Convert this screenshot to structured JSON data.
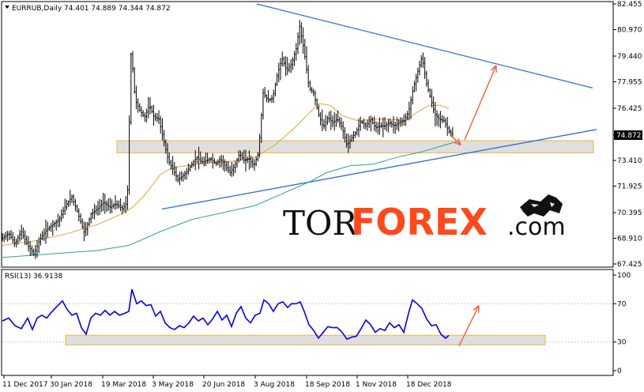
{
  "header": {
    "menu_icon": "triangle-down-icon",
    "symbol_info": "EURRUB,Daily  74.401 74.889 74.344 74.872"
  },
  "rsi_header": "RSI(13) 36.9138",
  "watermark": {
    "logo_icon": "bull-bear-icon",
    "tor": "TOR",
    "forex": "FOREX",
    "dotcom": ".com"
  },
  "colors": {
    "background": "#ffffff",
    "candle": "#000000",
    "ma_fast": "#e0a43a",
    "ma_slow": "#2aa58a",
    "trendline": "#2e6fd6",
    "arrow": "#ff5a3c",
    "zone_fill": "#d9d9d9",
    "zone_border": "#f0b43c",
    "rsi_line": "#0000ee",
    "watermark_tor": "#111111",
    "watermark_forex": "#ff4a1c"
  },
  "chart_data": [
    {
      "type": "candlestick",
      "symbol": "EURRUB",
      "timeframe": "Daily",
      "ylim": [
        67.425,
        82.455
      ],
      "y_ticks": [
        "82.455",
        "80.970",
        "79.440",
        "77.955",
        "76.425",
        "74.872",
        "73.410",
        "71.925",
        "70.395",
        "68.910",
        "67.425"
      ],
      "current_price": "74.872",
      "x_ticks": [
        "11 Dec 2017",
        "30 Jan 2018",
        "19 Mar 2018",
        "3 May 2018",
        "20 Jun 2018",
        "3 Aug 2018",
        "18 Sep 2018",
        "1 Nov 2018",
        "18 Dec 2018"
      ],
      "close_path": [
        [
          0,
          68.9
        ],
        [
          8,
          69.2
        ],
        [
          16,
          68.6
        ],
        [
          24,
          69.3
        ],
        [
          32,
          68.5
        ],
        [
          40,
          68.0
        ],
        [
          48,
          68.9
        ],
        [
          56,
          69.4
        ],
        [
          64,
          69.7
        ],
        [
          72,
          70.0
        ],
        [
          80,
          70.8
        ],
        [
          88,
          71.3
        ],
        [
          96,
          70.3
        ],
        [
          104,
          69.2
        ],
        [
          112,
          70.3
        ],
        [
          120,
          70.6
        ],
        [
          128,
          71.0
        ],
        [
          136,
          70.7
        ],
        [
          144,
          70.9
        ],
        [
          152,
          70.6
        ],
        [
          158,
          71.0
        ],
        [
          163,
          79.9
        ],
        [
          168,
          76.9
        ],
        [
          174,
          76.3
        ],
        [
          180,
          75.9
        ],
        [
          186,
          76.6
        ],
        [
          192,
          75.9
        ],
        [
          198,
          75.8
        ],
        [
          204,
          74.6
        ],
        [
          210,
          73.4
        ],
        [
          216,
          72.9
        ],
        [
          222,
          72.3
        ],
        [
          228,
          72.5
        ],
        [
          234,
          72.8
        ],
        [
          240,
          73.2
        ],
        [
          246,
          73.6
        ],
        [
          252,
          73.3
        ],
        [
          258,
          73.4
        ],
        [
          264,
          73.5
        ],
        [
          270,
          73.2
        ],
        [
          276,
          73.5
        ],
        [
          282,
          73.1
        ],
        [
          288,
          72.7
        ],
        [
          294,
          73.1
        ],
        [
          300,
          73.8
        ],
        [
          306,
          73.4
        ],
        [
          312,
          73.5
        ],
        [
          318,
          73.1
        ],
        [
          324,
          73.8
        ],
        [
          330,
          77.3
        ],
        [
          336,
          76.9
        ],
        [
          342,
          77.0
        ],
        [
          348,
          78.4
        ],
        [
          354,
          79.3
        ],
        [
          360,
          78.6
        ],
        [
          366,
          79.0
        ],
        [
          372,
          79.9
        ],
        [
          376,
          81.2
        ],
        [
          382,
          79.7
        ],
        [
          388,
          77.6
        ],
        [
          394,
          77.3
        ],
        [
          400,
          76.1
        ],
        [
          406,
          75.3
        ],
        [
          412,
          75.9
        ],
        [
          418,
          75.6
        ],
        [
          424,
          75.8
        ],
        [
          430,
          75.3
        ],
        [
          436,
          74.3
        ],
        [
          442,
          74.7
        ],
        [
          448,
          75.1
        ],
        [
          454,
          75.7
        ],
        [
          460,
          75.4
        ],
        [
          466,
          75.8
        ],
        [
          472,
          75.3
        ],
        [
          478,
          75.4
        ],
        [
          484,
          75.4
        ],
        [
          490,
          75.6
        ],
        [
          496,
          75.4
        ],
        [
          502,
          75.6
        ],
        [
          508,
          75.7
        ],
        [
          514,
          76.2
        ],
        [
          520,
          77.6
        ],
        [
          526,
          78.6
        ],
        [
          531,
          79.4
        ],
        [
          537,
          77.8
        ],
        [
          542,
          77.0
        ],
        [
          547,
          76.1
        ],
        [
          553,
          75.8
        ],
        [
          559,
          75.7
        ],
        [
          565,
          75.1
        ],
        [
          571,
          74.872
        ]
      ],
      "ma_fast_path": [
        [
          0,
          68.5
        ],
        [
          40,
          68.75
        ],
        [
          80,
          69.15
        ],
        [
          120,
          69.7
        ],
        [
          150,
          70.3
        ],
        [
          165,
          70.7
        ],
        [
          180,
          71.4
        ],
        [
          200,
          72.6
        ],
        [
          215,
          73.0
        ],
        [
          240,
          73.15
        ],
        [
          270,
          73.3
        ],
        [
          300,
          73.4
        ],
        [
          320,
          73.6
        ],
        [
          345,
          74.3
        ],
        [
          370,
          75.3
        ],
        [
          385,
          76.0
        ],
        [
          400,
          76.7
        ],
        [
          415,
          76.6
        ],
        [
          430,
          76.0
        ],
        [
          450,
          75.7
        ],
        [
          470,
          75.8
        ],
        [
          490,
          75.8
        ],
        [
          510,
          75.7
        ],
        [
          525,
          76.2
        ],
        [
          540,
          76.6
        ],
        [
          555,
          76.6
        ],
        [
          565,
          76.4
        ]
      ],
      "ma_slow_path": [
        [
          0,
          67.8
        ],
        [
          60,
          68.0
        ],
        [
          120,
          68.2
        ],
        [
          160,
          68.5
        ],
        [
          200,
          69.3
        ],
        [
          240,
          70.0
        ],
        [
          280,
          70.4
        ],
        [
          320,
          70.8
        ],
        [
          360,
          71.6
        ],
        [
          390,
          72.2
        ],
        [
          410,
          72.7
        ],
        [
          440,
          73.1
        ],
        [
          470,
          73.2
        ],
        [
          500,
          73.6
        ],
        [
          530,
          73.9
        ],
        [
          560,
          74.3
        ],
        [
          575,
          74.5
        ]
      ],
      "trendlines": [
        {
          "from": [
            325,
            82.455
          ],
          "to": [
            750,
            77.6
          ]
        },
        {
          "from": [
            205,
            70.6
          ],
          "to": [
            755,
            75.2
          ]
        }
      ],
      "support_zone": [
        73.85,
        74.55
      ],
      "forecast_arrows": [
        {
          "from": [
            568,
            74.85
          ],
          "to": [
            580,
            74.3
          ]
        },
        {
          "from": [
            585,
            74.6
          ],
          "to": [
            625,
            78.9
          ]
        }
      ]
    },
    {
      "type": "line",
      "name": "RSI(13)",
      "value": "36.9138",
      "ylim": [
        0,
        100
      ],
      "y_ticks": [
        "100",
        "70",
        "30",
        "0"
      ],
      "values": [
        [
          0,
          52
        ],
        [
          8,
          55
        ],
        [
          16,
          47
        ],
        [
          24,
          44
        ],
        [
          32,
          55
        ],
        [
          38,
          43
        ],
        [
          44,
          55
        ],
        [
          50,
          58
        ],
        [
          56,
          55
        ],
        [
          62,
          61
        ],
        [
          70,
          68
        ],
        [
          76,
          73
        ],
        [
          82,
          64
        ],
        [
          88,
          58
        ],
        [
          94,
          60
        ],
        [
          100,
          45
        ],
        [
          106,
          38
        ],
        [
          112,
          55
        ],
        [
          118,
          60
        ],
        [
          124,
          58
        ],
        [
          130,
          63
        ],
        [
          136,
          58
        ],
        [
          142,
          62
        ],
        [
          148,
          58
        ],
        [
          155,
          60
        ],
        [
          160,
          62
        ],
        [
          164,
          85
        ],
        [
          170,
          70
        ],
        [
          176,
          73
        ],
        [
          182,
          68
        ],
        [
          188,
          69
        ],
        [
          194,
          57
        ],
        [
          200,
          62
        ],
        [
          206,
          50
        ],
        [
          212,
          45
        ],
        [
          218,
          43
        ],
        [
          224,
          47
        ],
        [
          230,
          45
        ],
        [
          236,
          50
        ],
        [
          242,
          57
        ],
        [
          248,
          52
        ],
        [
          254,
          55
        ],
        [
          260,
          48
        ],
        [
          266,
          54
        ],
        [
          272,
          62
        ],
        [
          278,
          53
        ],
        [
          284,
          58
        ],
        [
          290,
          46
        ],
        [
          296,
          60
        ],
        [
          302,
          67
        ],
        [
          308,
          55
        ],
        [
          314,
          50
        ],
        [
          320,
          58
        ],
        [
          326,
          60
        ],
        [
          331,
          74
        ],
        [
          337,
          70
        ],
        [
          343,
          62
        ],
        [
          349,
          70
        ],
        [
          355,
          72
        ],
        [
          361,
          66
        ],
        [
          366,
          70
        ],
        [
          372,
          70
        ],
        [
          377,
          72
        ],
        [
          382,
          62
        ],
        [
          388,
          48
        ],
        [
          394,
          42
        ],
        [
          400,
          34
        ],
        [
          406,
          40
        ],
        [
          412,
          46
        ],
        [
          418,
          45
        ],
        [
          424,
          45
        ],
        [
          430,
          40
        ],
        [
          436,
          33
        ],
        [
          442,
          35
        ],
        [
          448,
          36
        ],
        [
          454,
          44
        ],
        [
          460,
          53
        ],
        [
          466,
          48
        ],
        [
          472,
          40
        ],
        [
          478,
          44
        ],
        [
          484,
          42
        ],
        [
          490,
          50
        ],
        [
          496,
          45
        ],
        [
          502,
          48
        ],
        [
          508,
          40
        ],
        [
          514,
          60
        ],
        [
          519,
          74
        ],
        [
          525,
          70
        ],
        [
          531,
          65
        ],
        [
          537,
          54
        ],
        [
          543,
          47
        ],
        [
          549,
          48
        ],
        [
          555,
          38
        ],
        [
          561,
          34
        ],
        [
          565,
          36.9
        ]
      ],
      "zone": [
        27,
        37
      ],
      "forecast_arrow": {
        "from": [
          578,
          26
        ],
        "to": [
          603,
          68
        ]
      }
    }
  ]
}
